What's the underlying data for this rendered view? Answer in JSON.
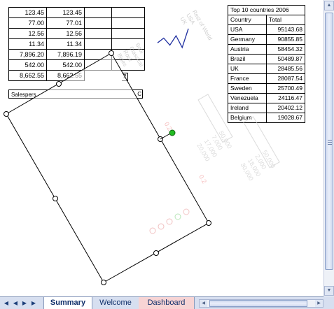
{
  "numbers_table": {
    "rows": [
      [
        "123.45",
        "123.45"
      ],
      [
        "77.00",
        "77.01"
      ],
      [
        "12.56",
        "12.56"
      ],
      [
        "11.34",
        "11.34"
      ],
      [
        "7,896.20",
        "7,896.19"
      ],
      [
        "542.00",
        "542.00"
      ]
    ],
    "total": [
      "8,662.55",
      "8,662.55"
    ]
  },
  "top10": {
    "title": "Top 10 countries 2006",
    "headers": [
      "Country",
      "Total"
    ],
    "rows": [
      [
        "USA",
        "95143.68"
      ],
      [
        "Germany",
        "90855.85"
      ],
      [
        "Austria",
        "58454.32"
      ],
      [
        "Brazil",
        "50489.87"
      ],
      [
        "UK",
        "28485.56"
      ],
      [
        "France",
        "28087.54"
      ],
      [
        "Sweden",
        "25700.49"
      ],
      [
        "Venezuela",
        "24116.47"
      ],
      [
        "Ireland",
        "20402.12"
      ],
      [
        "Belgium",
        "19028.67"
      ]
    ]
  },
  "salesperson_label": "Salespers",
  "salesperson_tail": "C",
  "partial_cell": "2",
  "rotated_chart": {
    "legend": [
      "Blues",
      "Rock",
      "Classical",
      "Soul",
      "UK",
      "USA",
      "Rest of World"
    ],
    "values_a": [
      "20,000",
      "17,000",
      "7,000",
      "50,000"
    ],
    "values_b": [
      "30,000",
      "18,000",
      "2,000",
      "50,000"
    ],
    "small": [
      "0.2",
      "0.2"
    ],
    "selection_handle_color": "#22bb22"
  },
  "tabs": {
    "nav": [
      "first-arrow",
      "prev-arrow",
      "next-arrow",
      "last-arrow"
    ],
    "items": [
      {
        "label": "Summary",
        "active": true
      },
      {
        "label": "Welcome",
        "active": false
      },
      {
        "label": "Dashboard",
        "active": false,
        "color": "#f7d4d4"
      }
    ]
  },
  "sparkline": {
    "values": [
      3,
      5,
      2,
      6,
      1,
      9
    ],
    "color": "#1f2fa0"
  }
}
